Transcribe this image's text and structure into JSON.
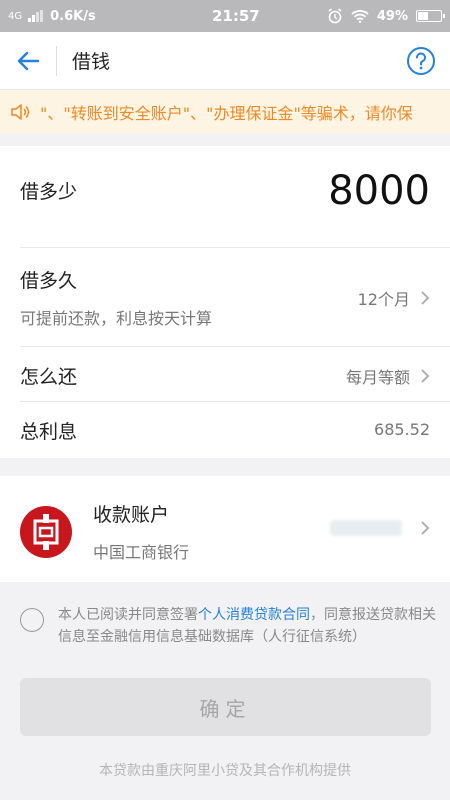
{
  "status": {
    "network": "4G",
    "speed": "0.6K/s",
    "time": "21:57",
    "battery": "49%",
    "battery_level": 0.49
  },
  "nav": {
    "title": "借钱"
  },
  "notice": {
    "text": "\"、\"转账到安全账户\"、\"办理保证金\"等骗术，请你保"
  },
  "loan": {
    "amount_label": "借多少",
    "amount": "8000",
    "term_label": "借多久",
    "term_sub": "可提前还款，利息按天计算",
    "term_value": "12个月",
    "repay_label": "怎么还",
    "repay_value": "每月等额",
    "interest_label": "总利息",
    "interest_value": "685.52"
  },
  "account": {
    "label": "收款账户",
    "bank": "中国工商银行"
  },
  "agreement": {
    "pre": "本人已阅读并同意签署",
    "link": "个人消费贷款合同",
    "post": "，同意报送贷款相关信息至金融信用信息基础数据库（人行征信系统）"
  },
  "confirm_label": "确定",
  "footer": "本贷款由重庆阿里小贷及其合作机构提供",
  "colors": {
    "accent": "#2680d9",
    "notice_text": "#f08a24",
    "bank_red": "#c8161d"
  }
}
